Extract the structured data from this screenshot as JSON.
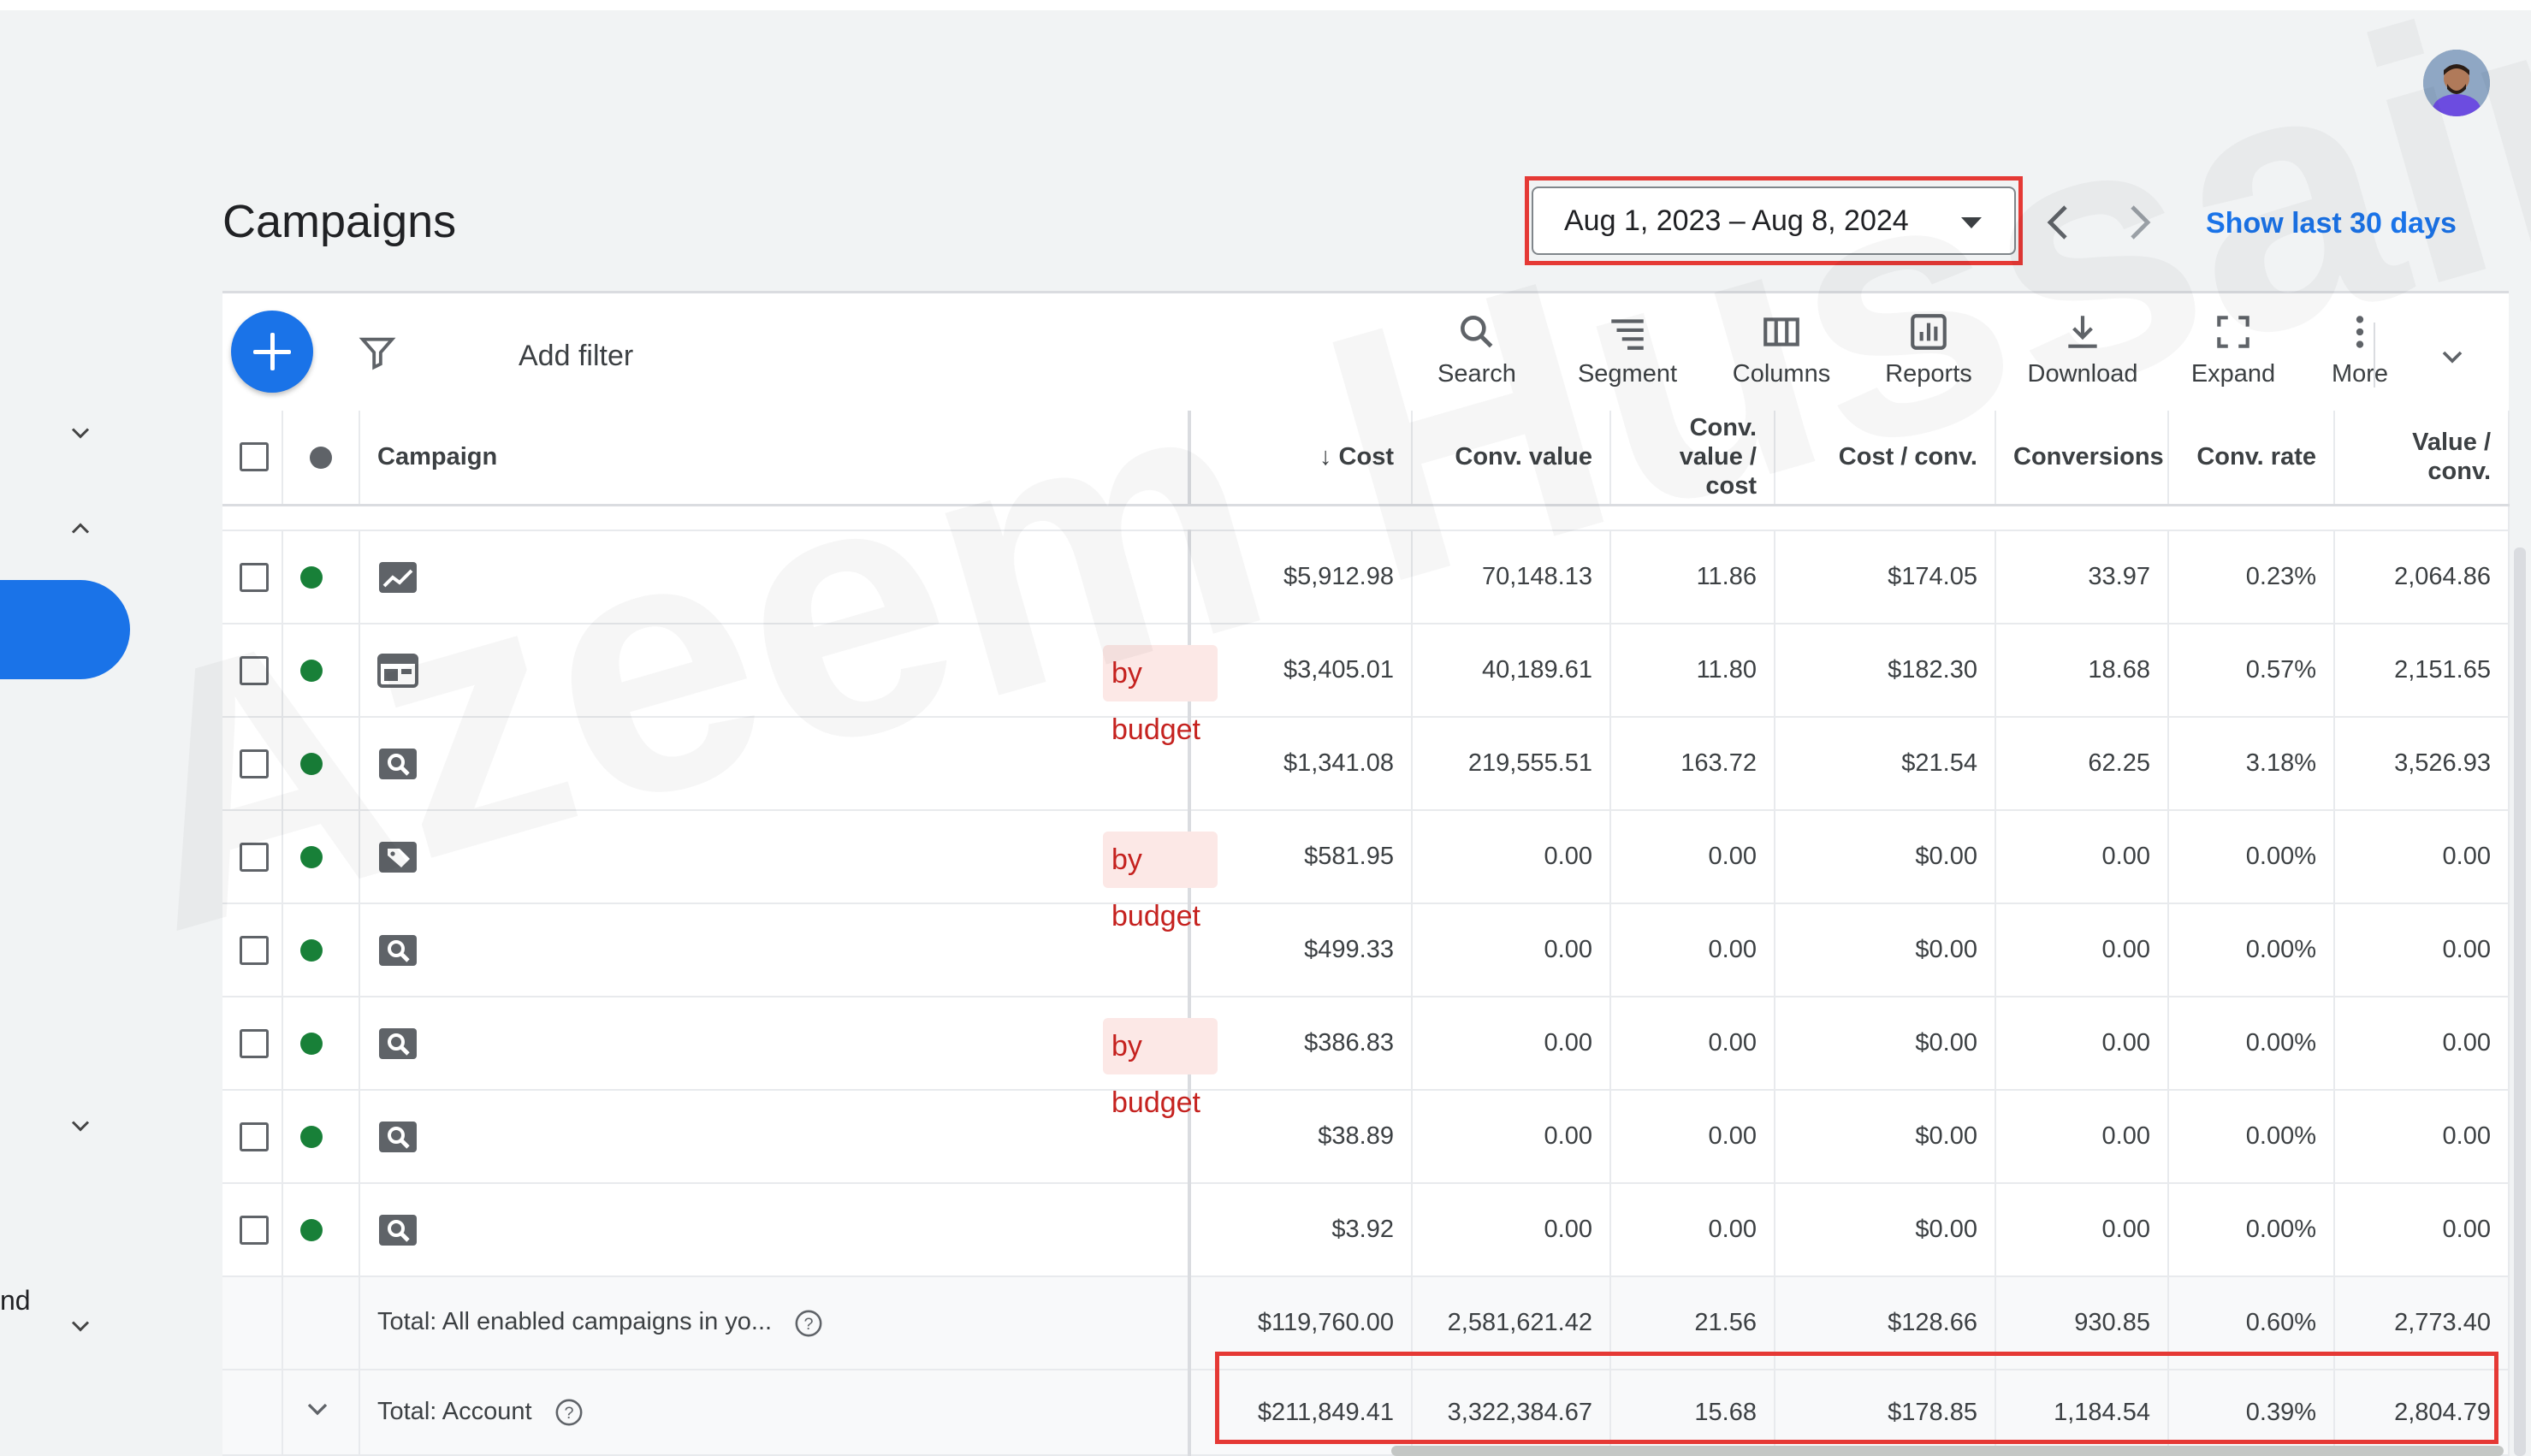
{
  "header": {
    "title": "Campaigns",
    "date_range": "Aug 1, 2023 – Aug 8, 2024",
    "show_last_label": "Show last 30 days"
  },
  "sidebar": {
    "partial_label": "nd"
  },
  "toolbar": {
    "add_filter_label": "Add filter",
    "tools": [
      "Search",
      "Segment",
      "Columns",
      "Reports",
      "Download",
      "Expand",
      "More"
    ]
  },
  "table": {
    "columns": [
      "Campaign",
      "Cost",
      "Conv. value",
      "Conv. value / cost",
      "Cost / conv.",
      "Conversions",
      "Conv. rate",
      "Value / conv."
    ],
    "rows": [
      {
        "type_icon": "performance-max-icon",
        "status_badge": "",
        "cost": "$5,912.98",
        "conv_value": "70,148.13",
        "conv_value_cost": "11.86",
        "cost_conv": "$174.05",
        "conversions": "33.97",
        "conv_rate": "0.23%",
        "value_conv": "2,064.86"
      },
      {
        "type_icon": "display-icon",
        "status_badge": "by budget",
        "cost": "$3,405.01",
        "conv_value": "40,189.61",
        "conv_value_cost": "11.80",
        "cost_conv": "$182.30",
        "conversions": "18.68",
        "conv_rate": "0.57%",
        "value_conv": "2,151.65"
      },
      {
        "type_icon": "search-campaign-icon",
        "status_badge": "",
        "cost": "$1,341.08",
        "conv_value": "219,555.51",
        "conv_value_cost": "163.72",
        "cost_conv": "$21.54",
        "conversions": "62.25",
        "conv_rate": "3.18%",
        "value_conv": "3,526.93"
      },
      {
        "type_icon": "shopping-tag-icon",
        "status_badge": "by budget",
        "cost": "$581.95",
        "conv_value": "0.00",
        "conv_value_cost": "0.00",
        "cost_conv": "$0.00",
        "conversions": "0.00",
        "conv_rate": "0.00%",
        "value_conv": "0.00"
      },
      {
        "type_icon": "search-campaign-icon",
        "status_badge": "",
        "cost": "$499.33",
        "conv_value": "0.00",
        "conv_value_cost": "0.00",
        "cost_conv": "$0.00",
        "conversions": "0.00",
        "conv_rate": "0.00%",
        "value_conv": "0.00"
      },
      {
        "type_icon": "search-campaign-icon",
        "status_badge": "by budget",
        "cost": "$386.83",
        "conv_value": "0.00",
        "conv_value_cost": "0.00",
        "cost_conv": "$0.00",
        "conversions": "0.00",
        "conv_rate": "0.00%",
        "value_conv": "0.00"
      },
      {
        "type_icon": "search-campaign-icon",
        "status_badge": "",
        "cost": "$38.89",
        "conv_value": "0.00",
        "conv_value_cost": "0.00",
        "cost_conv": "$0.00",
        "conversions": "0.00",
        "conv_rate": "0.00%",
        "value_conv": "0.00"
      },
      {
        "type_icon": "search-campaign-icon",
        "status_badge": "",
        "cost": "$3.92",
        "conv_value": "0.00",
        "conv_value_cost": "0.00",
        "cost_conv": "$0.00",
        "conversions": "0.00",
        "conv_rate": "0.00%",
        "value_conv": "0.00"
      }
    ],
    "totals": [
      {
        "label": "Total: All enabled campaigns in yo...",
        "cost": "$119,760.00",
        "conv_value": "2,581,621.42",
        "conv_value_cost": "21.56",
        "cost_conv": "$128.66",
        "conversions": "930.85",
        "conv_rate": "0.60%",
        "value_conv": "2,773.40"
      },
      {
        "label": "Total: Account",
        "cost": "$211,849.41",
        "conv_value": "3,322,384.67",
        "conv_value_cost": "15.68",
        "cost_conv": "$178.85",
        "conversions": "1,184.54",
        "conv_rate": "0.39%",
        "value_conv": "2,804.79"
      }
    ]
  },
  "watermark": "Azeem Hussain",
  "colors": {
    "accent": "#1a73e8",
    "status_enabled": "#188038",
    "highlight": "#e53935",
    "limited_badge_bg": "#fce8e6",
    "limited_badge_text": "#c5221f"
  }
}
